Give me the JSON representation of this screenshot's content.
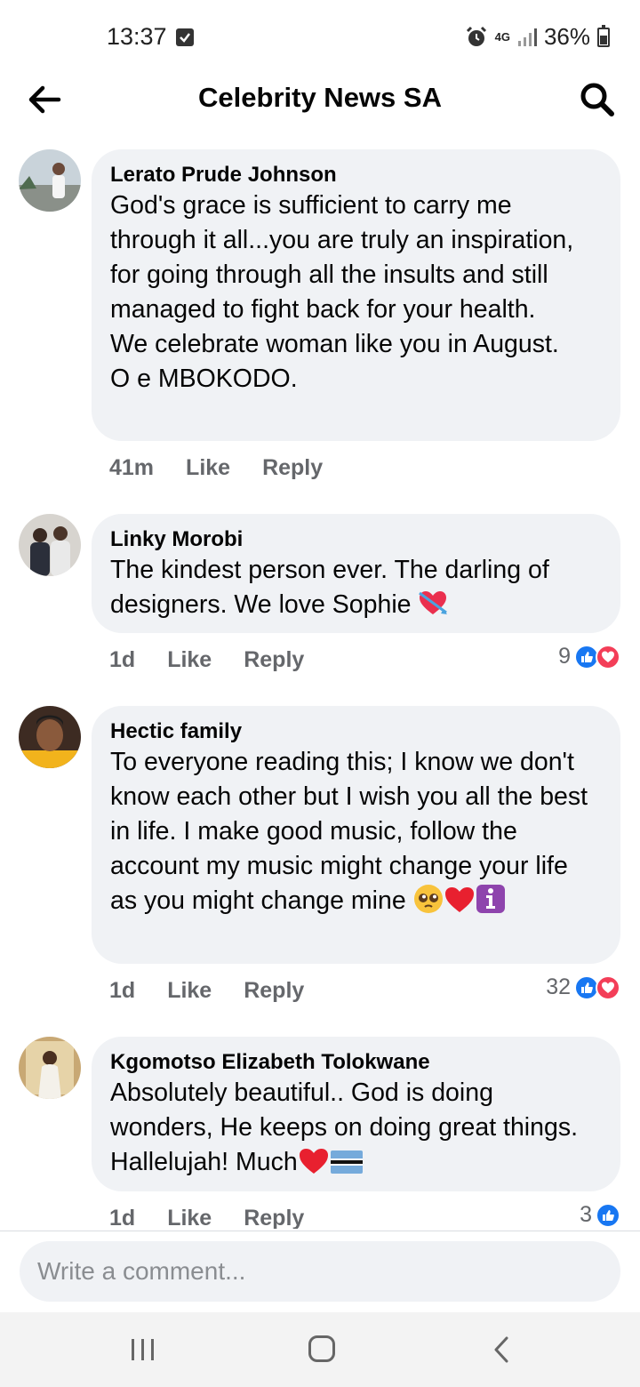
{
  "status": {
    "time": "13:37",
    "network": "4G",
    "battery": "36%"
  },
  "header": {
    "title": "Celebrity News SA"
  },
  "comments": [
    {
      "author": "Lerato Prude Johnson",
      "text": "God's grace is sufficient to carry me through it all...you are truly an inspiration, for going through all the insults and still managed to fight back for your health.\nWe celebrate woman like you in August.\nO e MBOKODO.",
      "time": "41m",
      "like": "Like",
      "reply": "Reply",
      "reaction_count": ""
    },
    {
      "author": "Linky Morobi",
      "text": "The kindest person ever. The darling of designers. We love Sophie",
      "time": "1d",
      "like": "Like",
      "reply": "Reply",
      "reaction_count": "9",
      "reactions": [
        "like",
        "love"
      ]
    },
    {
      "author": "Hectic family",
      "text": "To everyone reading this; I know we don't know each other but I wish you all the best in life. I make good music, follow the account my music might change your life as you might change mine",
      "time": "1d",
      "like": "Like",
      "reply": "Reply",
      "reaction_count": "32",
      "reactions": [
        "like",
        "love"
      ]
    },
    {
      "author": "Kgomotso Elizabeth Tolokwane",
      "text": "Absolutely beautiful.. God is doing wonders, He keeps on doing great things.  Hallelujah! Much",
      "time": "1d",
      "like": "Like",
      "reply": "Reply",
      "reaction_count": "3",
      "reactions": [
        "like"
      ]
    }
  ],
  "composer": {
    "placeholder": "Write a comment..."
  },
  "colors": {
    "bubble": "#f0f2f5",
    "like_blue": "#1877f2",
    "love_red": "#f33e58",
    "meta_gray": "#65676b"
  }
}
